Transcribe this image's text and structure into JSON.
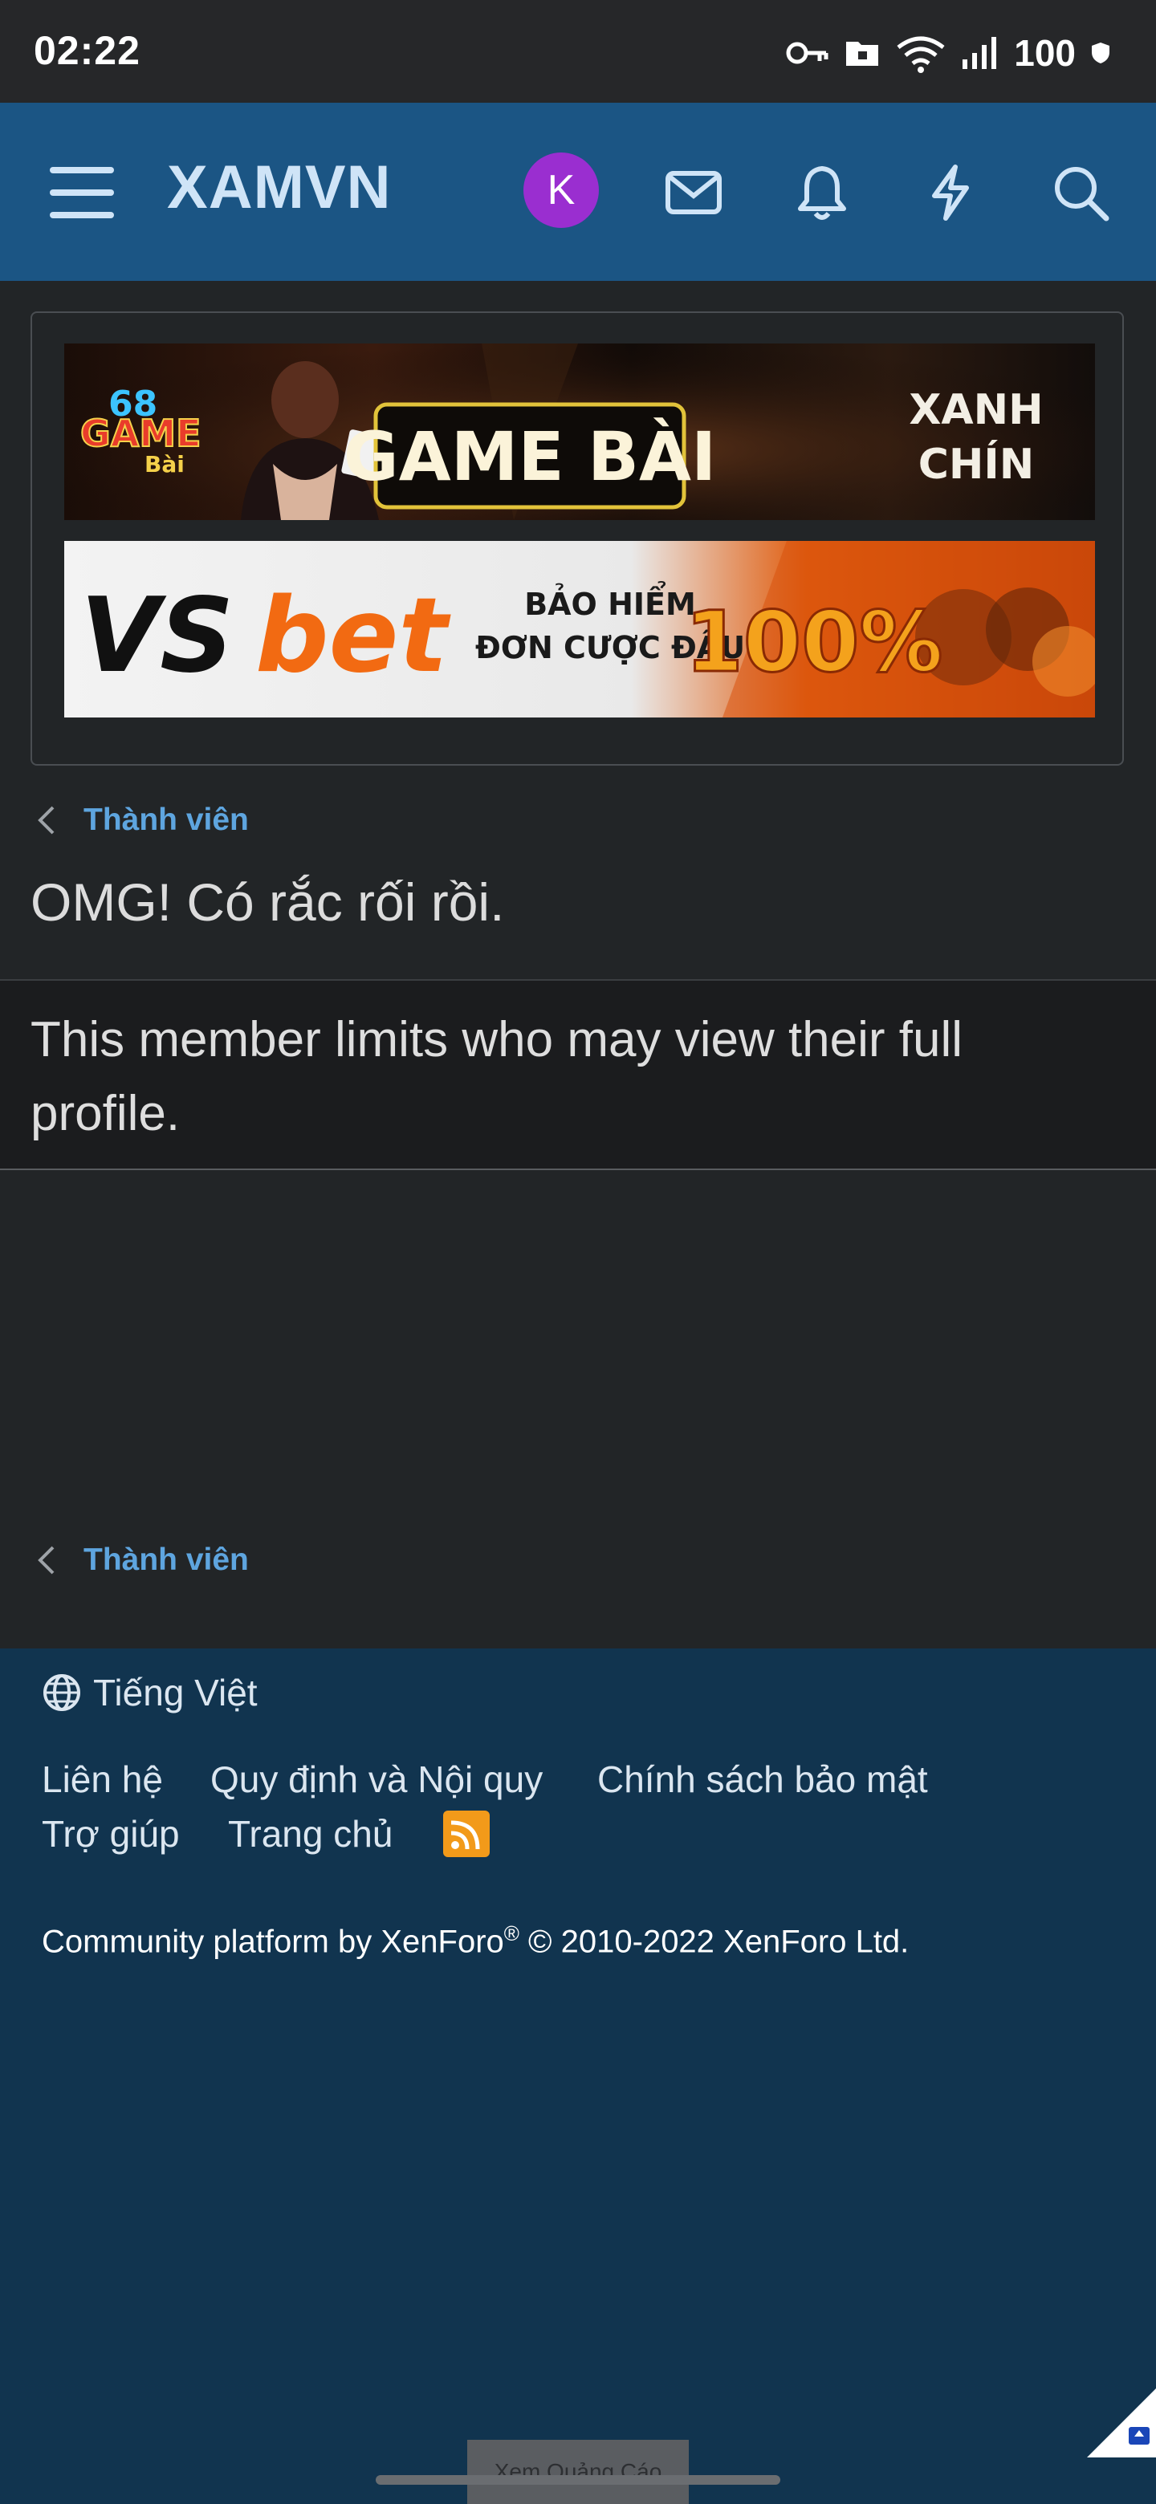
{
  "status_bar": {
    "time": "02:22",
    "battery": "100"
  },
  "header": {
    "brand": "XAMVN",
    "avatar_letter": "K",
    "icons": [
      "menu-icon",
      "envelope-icon",
      "bell-icon",
      "bolt-icon",
      "search-icon"
    ]
  },
  "ads": {
    "banner1": {
      "logo_num": "68",
      "logo_word": "GAME",
      "logo_sub": "Bài",
      "headline": "GAME BÀI",
      "tag1": "XANH",
      "tag2": "CHÍN"
    },
    "banner2": {
      "brand_a": "VS",
      "brand_b": "bet",
      "line1": "BẢO HIỂM",
      "line2": "ĐƠN CƯỢC ĐẦU",
      "percent": "100%"
    }
  },
  "breadcrumb": {
    "label": "Thành viên"
  },
  "page_title": "OMG! Có rắc rối rồi.",
  "notice": "This member limits who may view their full profile.",
  "footer": {
    "language": "Tiếng Việt",
    "links": [
      "Liên hệ",
      "Quy định và Nội quy",
      "Chính sách bảo mật",
      "Trợ giúp",
      "Trang chủ"
    ],
    "copyright_a": "Community platform by XenForo",
    "copyright_reg": "®",
    "copyright_b": " © 2010-2022 XenForo Ltd."
  },
  "ad_button": "Xem Quảng Cáo",
  "colors": {
    "header_bg": "#1b5584",
    "footer_bg": "#11344f",
    "link": "#5ea5df",
    "avatar": "#9a2ed0",
    "rss": "#f29a1a"
  }
}
